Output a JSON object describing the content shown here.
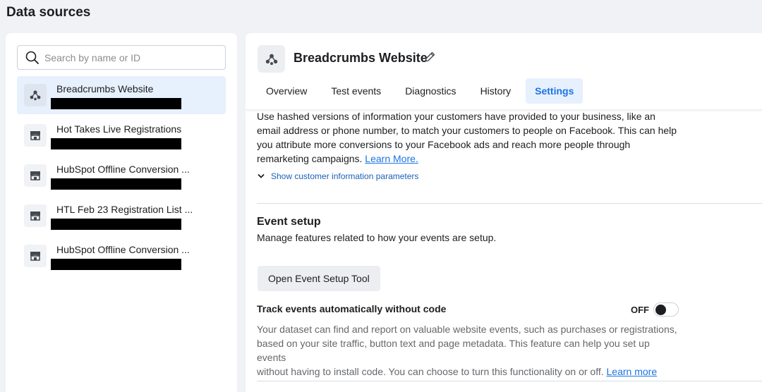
{
  "page": {
    "title": "Data sources"
  },
  "search": {
    "placeholder": "Search by name or ID"
  },
  "sources": [
    {
      "name": "Breadcrumbs Website",
      "icon": "pixel-icon",
      "active": true
    },
    {
      "name": "Hot Takes Live Registrations",
      "icon": "store-icon",
      "active": false
    },
    {
      "name": "HubSpot Offline Conversion ...",
      "icon": "store-icon",
      "active": false
    },
    {
      "name": "HTL Feb 23 Registration List ...",
      "icon": "store-icon",
      "active": false
    },
    {
      "name": "HubSpot Offline Conversion ...",
      "icon": "store-icon",
      "active": false
    }
  ],
  "detail": {
    "title": "Breadcrumbs Website",
    "tabs": [
      {
        "label": "Overview",
        "active": false
      },
      {
        "label": "Test events",
        "active": false
      },
      {
        "label": "Diagnostics",
        "active": false
      },
      {
        "label": "History",
        "active": false
      },
      {
        "label": "Settings",
        "active": true
      }
    ]
  },
  "customer_info": {
    "text_lines": [
      "Use hashed versions of information your customers have provided to your business, like an",
      "email address or phone number, to match your customers to people on Facebook. This can help",
      "you attribute more conversions to your Facebook ads and reach more people through"
    ],
    "last_line": "remarketing campaigns.",
    "learn_more": "Learn More.",
    "show_params": "Show customer information parameters"
  },
  "event_setup": {
    "title": "Event setup",
    "description": "Manage features related to how your events are setup.",
    "button": "Open Event Setup Tool",
    "track_label": "Track events automatically without code",
    "toggle_state": "OFF",
    "desc_lines": [
      "Your dataset can find and report on valuable website events, such as purchases or registrations,",
      "based on your site traffic, button text and page metadata. This feature can help you set up events"
    ],
    "desc_last": "without having to install code. You can choose to turn this functionality on or off.",
    "learn_more": "Learn more"
  },
  "colors": {
    "accent": "#1b74e4",
    "active_bg": "#e7f0fd",
    "page_bg": "#f0f2f5"
  }
}
